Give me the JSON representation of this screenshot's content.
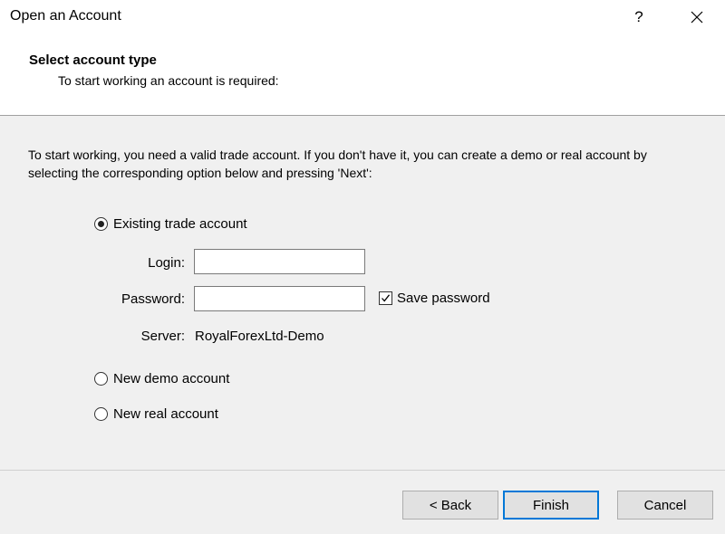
{
  "window": {
    "title": "Open an Account",
    "help_label": "?"
  },
  "header": {
    "title": "Select account type",
    "subtitle": "To start working an account is required:"
  },
  "description": "To start working, you need a valid trade account. If you don't have it, you can create a demo or real account by selecting the corresponding option below and pressing 'Next':",
  "options": {
    "existing": {
      "label": "Existing trade account",
      "selected": true
    },
    "demo": {
      "label": "New demo account",
      "selected": false
    },
    "real": {
      "label": "New real account",
      "selected": false
    }
  },
  "form": {
    "login_label": "Login:",
    "login_value": "",
    "password_label": "Password:",
    "password_value": "",
    "save_password_label": "Save password",
    "save_password_checked": true,
    "server_label": "Server:",
    "server_value": "RoyalForexLtd-Demo"
  },
  "buttons": {
    "back": "< Back",
    "finish": "Finish",
    "cancel": "Cancel"
  }
}
